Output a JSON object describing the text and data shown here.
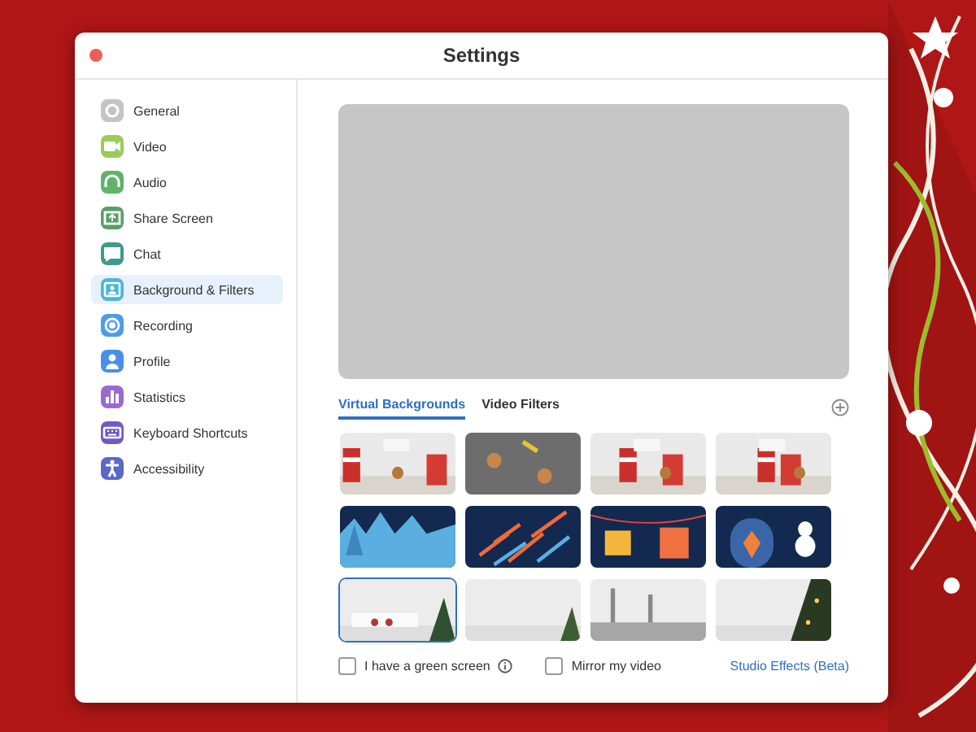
{
  "window": {
    "title": "Settings"
  },
  "sidebar": {
    "items": [
      {
        "label": "General",
        "selected": false,
        "color": "#c4c4c4"
      },
      {
        "label": "Video",
        "selected": false,
        "color": "#9ccb5a"
      },
      {
        "label": "Audio",
        "selected": false,
        "color": "#5fb36a"
      },
      {
        "label": "Share Screen",
        "selected": false,
        "color": "#5a9e68"
      },
      {
        "label": "Chat",
        "selected": false,
        "color": "#3e9a8c"
      },
      {
        "label": "Background & Filters",
        "selected": true,
        "color": "#4cb6d4"
      },
      {
        "label": "Recording",
        "selected": false,
        "color": "#4f9de8"
      },
      {
        "label": "Profile",
        "selected": false,
        "color": "#4a8ee6"
      },
      {
        "label": "Statistics",
        "selected": false,
        "color": "#9a6ad0"
      },
      {
        "label": "Keyboard Shortcuts",
        "selected": false,
        "color": "#6f5bc8"
      },
      {
        "label": "Accessibility",
        "selected": false,
        "color": "#5a68c6"
      }
    ]
  },
  "tabs": [
    {
      "label": "Virtual Backgrounds",
      "selected": true
    },
    {
      "label": "Video Filters",
      "selected": false
    }
  ],
  "backgrounds": [
    {
      "kind": "picture",
      "selected": false
    },
    {
      "kind": "picture",
      "selected": false
    },
    {
      "kind": "picture",
      "selected": false
    },
    {
      "kind": "picture",
      "selected": false
    },
    {
      "kind": "picture",
      "selected": false
    },
    {
      "kind": "picture",
      "selected": false
    },
    {
      "kind": "picture",
      "selected": false
    },
    {
      "kind": "picture",
      "selected": false
    },
    {
      "kind": "picture",
      "selected": true
    },
    {
      "kind": "picture",
      "selected": false
    },
    {
      "kind": "picture",
      "selected": false
    },
    {
      "kind": "picture",
      "selected": false
    }
  ],
  "options": [
    {
      "label": "I have a green screen",
      "checked": false,
      "info": true
    },
    {
      "label": "Mirror my video",
      "checked": false,
      "info": false
    }
  ],
  "studio_link": "Studio Effects (Beta)"
}
